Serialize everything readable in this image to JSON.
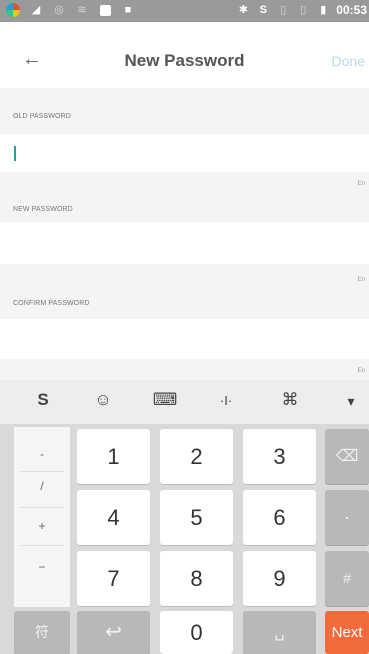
{
  "status_bar": {
    "time": "00:53",
    "icons": [
      "app-icon",
      "signal-icon",
      "alarm-icon",
      "wifi-icon",
      "image-icon",
      "notification-icon",
      "bluetooth-icon",
      "sogou-icon",
      "sim-icon",
      "sim2-icon",
      "battery-icon"
    ]
  },
  "header": {
    "back_icon": "←",
    "title": "New Password",
    "done_label": "Done"
  },
  "form": {
    "old_password_label": "OLD PASSWORD",
    "new_password_label": "NEW PASSWORD",
    "confirm_password_label": "CONFIRM PASSWORD",
    "hint_1": "En",
    "hint_2": "En",
    "hint_3": "En"
  },
  "keyboard": {
    "toolbar": [
      "S",
      "☺",
      "⌨",
      "·I·",
      "⌘",
      "▾"
    ],
    "symbols": [
      "-",
      "/",
      "+",
      "−"
    ],
    "digits": [
      "1",
      "2",
      "3",
      "4",
      "5",
      "6",
      "7",
      "8",
      "9",
      "0"
    ],
    "delete_icon": "⌫",
    "dot_label": "·",
    "hash_label": "#",
    "han_label": "符",
    "return_icon": "↩",
    "space_icon": "␣",
    "next_label": "Next"
  },
  "colors": {
    "accent": "#1aa39e",
    "next_key": "#f26b3a",
    "done_text": "#b9d8ea"
  }
}
